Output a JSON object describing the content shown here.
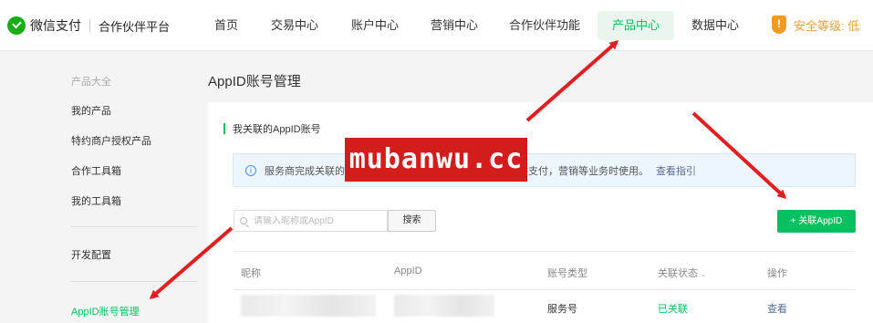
{
  "brand": {
    "name": "微信支付",
    "subtitle": "合作伙伴平台"
  },
  "nav": {
    "items": [
      {
        "label": "首页",
        "active": false
      },
      {
        "label": "交易中心",
        "active": false
      },
      {
        "label": "账户中心",
        "active": false
      },
      {
        "label": "营销中心",
        "active": false
      },
      {
        "label": "合作伙伴功能",
        "active": false
      },
      {
        "label": "产品中心",
        "active": true
      },
      {
        "label": "数据中心",
        "active": false
      }
    ],
    "security": {
      "icon": "!",
      "label": "安全等级: 低"
    }
  },
  "sidebar": {
    "section_label": "产品大全",
    "items": [
      {
        "label": "我的产品",
        "active": false
      },
      {
        "label": "特约商户授权产品",
        "active": false
      },
      {
        "label": "合作工具箱",
        "active": false
      },
      {
        "label": "我的工具箱",
        "active": false
      },
      {
        "label": "开发配置",
        "active": false
      },
      {
        "label": "AppID账号管理",
        "active": true
      }
    ]
  },
  "main": {
    "page_title": "AppID账号管理",
    "section_title": "我关联的AppID账号",
    "notice": {
      "text_start": "服务商完成关联的",
      "text_end": "供支付，营销等业务时使用。",
      "link": "查看指引"
    },
    "search": {
      "placeholder": "请输入昵称或AppID",
      "value": "",
      "button": "搜索"
    },
    "add_button": "+ 关联AppID",
    "table": {
      "headers": [
        "昵称",
        "AppID",
        "账号类型",
        "关联状态",
        "操作"
      ],
      "rows": [
        {
          "nickname": "",
          "appid": "",
          "type": "服务号",
          "status": "已关联",
          "action": "查看"
        }
      ]
    }
  },
  "watermark": "mubanwu.cc",
  "colors": {
    "accent": "#07c160",
    "warning": "#f09b25",
    "link": "#576b95",
    "watermark": "#d31c1c"
  }
}
